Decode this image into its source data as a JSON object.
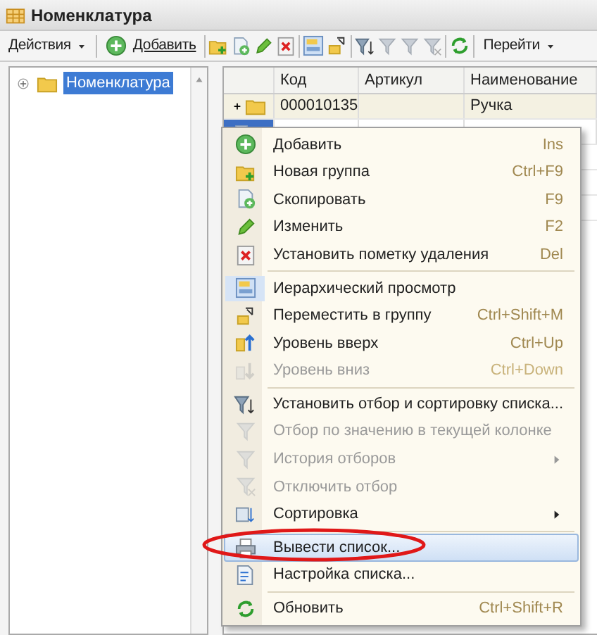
{
  "window": {
    "title": "Номенклатура"
  },
  "toolbar": {
    "actions": "Действия",
    "add": "Добавить",
    "goto": "Перейти"
  },
  "tree": {
    "items": [
      {
        "label": "Номенклатура",
        "selected": true,
        "expanded": false
      }
    ]
  },
  "table": {
    "columns": [
      "Код",
      "Артикул",
      "Наименование"
    ],
    "rows": [
      {
        "kind": "group",
        "cells": [
          "000010135",
          "",
          "Ручка"
        ],
        "selected": false
      },
      {
        "kind": "item",
        "selected": true
      }
    ]
  },
  "context_menu": {
    "items": [
      {
        "kind": "item",
        "label": "Добавить",
        "shortcut": "Ins",
        "disabled": false,
        "selected": false
      },
      {
        "kind": "item",
        "label": "Новая группа",
        "shortcut": "Ctrl+F9",
        "disabled": false,
        "selected": false
      },
      {
        "kind": "item",
        "label": "Скопировать",
        "shortcut": "F9",
        "disabled": false,
        "selected": false
      },
      {
        "kind": "item",
        "label": "Изменить",
        "shortcut": "F2",
        "disabled": false,
        "selected": false
      },
      {
        "kind": "item",
        "label": "Установить пометку удаления",
        "shortcut": "Del",
        "disabled": false,
        "selected": false
      },
      {
        "kind": "separator"
      },
      {
        "kind": "item",
        "label": "Иерархический просмотр",
        "disabled": false,
        "selected": false,
        "checked": true
      },
      {
        "kind": "item",
        "label": "Переместить в группу",
        "shortcut": "Ctrl+Shift+M",
        "disabled": false,
        "selected": false
      },
      {
        "kind": "item",
        "label": "Уровень вверх",
        "shortcut": "Ctrl+Up",
        "disabled": false,
        "selected": false
      },
      {
        "kind": "item",
        "label": "Уровень вниз",
        "shortcut": "Ctrl+Down",
        "disabled": true,
        "selected": false
      },
      {
        "kind": "separator"
      },
      {
        "kind": "item",
        "label": "Установить отбор и сортировку списка...",
        "disabled": false,
        "selected": false
      },
      {
        "kind": "item",
        "label": "Отбор по значению в текущей колонке",
        "disabled": true,
        "selected": false
      },
      {
        "kind": "submenu",
        "label": "История отборов",
        "disabled": true,
        "selected": false
      },
      {
        "kind": "item",
        "label": "Отключить отбор",
        "disabled": true,
        "selected": false
      },
      {
        "kind": "submenu",
        "label": "Сортировка",
        "disabled": false,
        "selected": false
      },
      {
        "kind": "separator"
      },
      {
        "kind": "item",
        "label": "Вывести список...",
        "disabled": false,
        "selected": true
      },
      {
        "kind": "item",
        "label": "Настройка списка...",
        "disabled": false,
        "selected": false
      },
      {
        "kind": "separator"
      },
      {
        "kind": "item",
        "label": "Обновить",
        "shortcut": "Ctrl+Shift+R",
        "disabled": false,
        "selected": false
      }
    ]
  },
  "annotation": {
    "kind": "ellipse"
  }
}
